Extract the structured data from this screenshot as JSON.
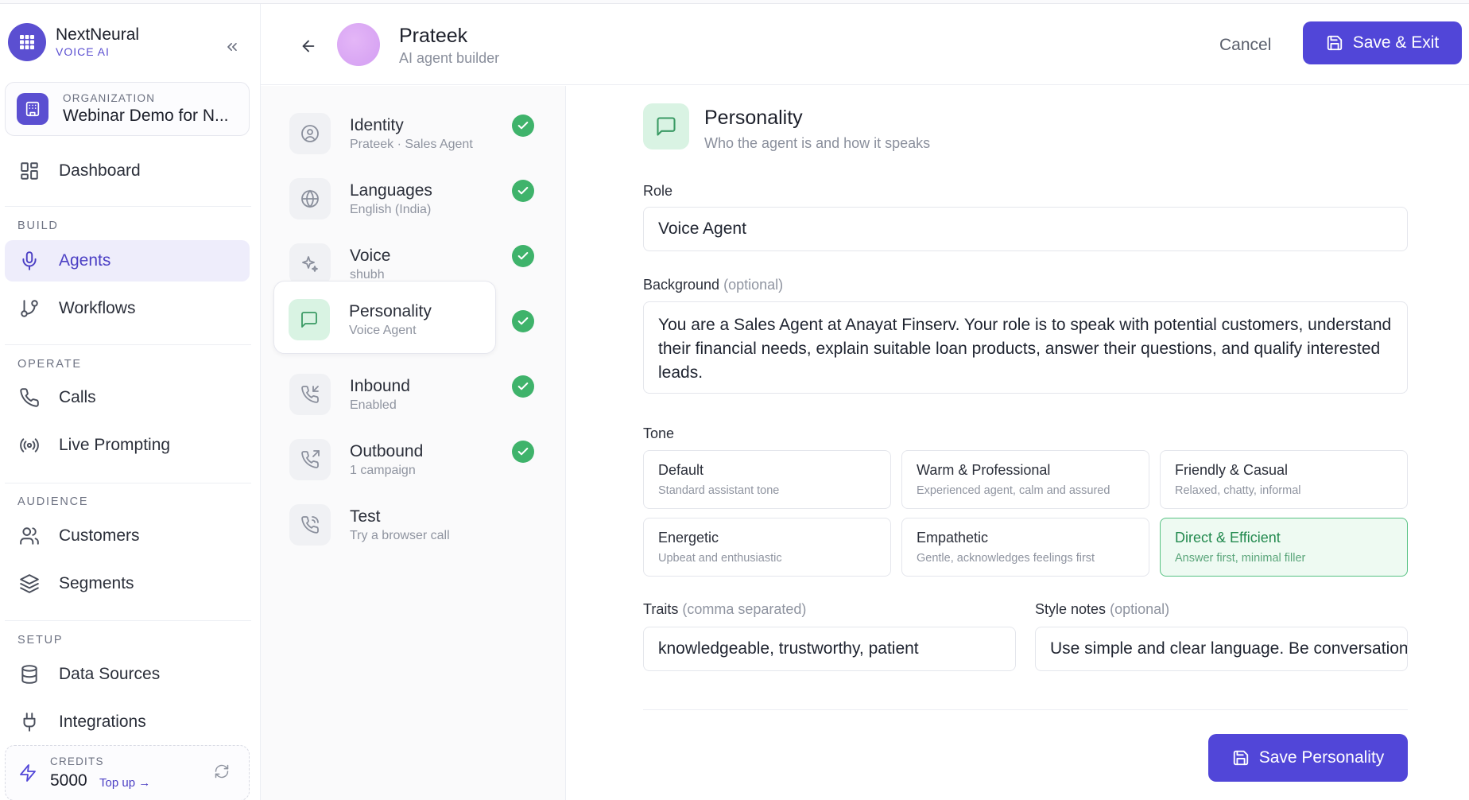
{
  "brand": {
    "name": "NextNeural",
    "sub": "VOICE AI"
  },
  "org": {
    "label": "ORGANIZATION",
    "name": "Webinar Demo for N..."
  },
  "nav": {
    "dashboard": "Dashboard",
    "sections": {
      "build": "BUILD",
      "operate": "OPERATE",
      "audience": "AUDIENCE",
      "setup": "SETUP"
    },
    "agents": "Agents",
    "workflows": "Workflows",
    "calls": "Calls",
    "live_prompting": "Live Prompting",
    "customers": "Customers",
    "segments": "Segments",
    "data_sources": "Data Sources",
    "integrations": "Integrations"
  },
  "credits": {
    "label": "CREDITS",
    "value": "5000",
    "topup": "Top up →"
  },
  "header": {
    "agent_name": "Prateek",
    "agent_sub": "AI agent builder",
    "cancel": "Cancel",
    "save_exit": "Save & Exit"
  },
  "steps": [
    {
      "title": "Identity",
      "sub": "Prateek · Sales Agent",
      "icon": "user-circle-icon",
      "done": true
    },
    {
      "title": "Languages",
      "sub": "English (India)",
      "icon": "globe-icon",
      "done": true
    },
    {
      "title": "Voice",
      "sub": "shubh",
      "icon": "sparkle-icon",
      "done": true
    },
    {
      "title": "Personality",
      "sub": "Voice Agent",
      "icon": "message-square-icon",
      "done": true
    },
    {
      "title": "Inbound",
      "sub": "Enabled",
      "icon": "phone-incoming-icon",
      "done": true
    },
    {
      "title": "Outbound",
      "sub": "1 campaign",
      "icon": "phone-outgoing-icon",
      "done": true
    },
    {
      "title": "Test",
      "sub": "Try a browser call",
      "icon": "phone-call-icon",
      "done": false
    }
  ],
  "section": {
    "title": "Personality",
    "sub": "Who the agent is and how it speaks"
  },
  "form": {
    "role_label": "Role",
    "role_value": "Voice Agent",
    "background_label": "Background",
    "background_opt": "(optional)",
    "background_value": "You are a Sales Agent at Anayat Finserv. Your role is to speak with potential customers, understand their financial needs, explain suitable loan products, answer their questions, and qualify interested leads.",
    "tone_label": "Tone",
    "tones": [
      {
        "name": "Default",
        "desc": "Standard assistant tone",
        "selected": false
      },
      {
        "name": "Warm & Professional",
        "desc": "Experienced agent, calm and assured",
        "selected": false
      },
      {
        "name": "Friendly & Casual",
        "desc": "Relaxed, chatty, informal",
        "selected": false
      },
      {
        "name": "Energetic",
        "desc": "Upbeat and enthusiastic",
        "selected": false
      },
      {
        "name": "Empathetic",
        "desc": "Gentle, acknowledges feelings first",
        "selected": false
      },
      {
        "name": "Direct & Efficient",
        "desc": "Answer first, minimal filler",
        "selected": true
      }
    ],
    "traits_label": "Traits",
    "traits_opt": "(comma separated)",
    "traits_value": "knowledgeable, trustworthy, patient",
    "style_label": "Style notes",
    "style_opt": "(optional)",
    "style_value": "Use simple and clear language. Be conversational",
    "save_button": "Save Personality"
  },
  "colors": {
    "accent": "#5146d8",
    "success": "#3fb36b",
    "selected_bg": "#eefaf2"
  }
}
